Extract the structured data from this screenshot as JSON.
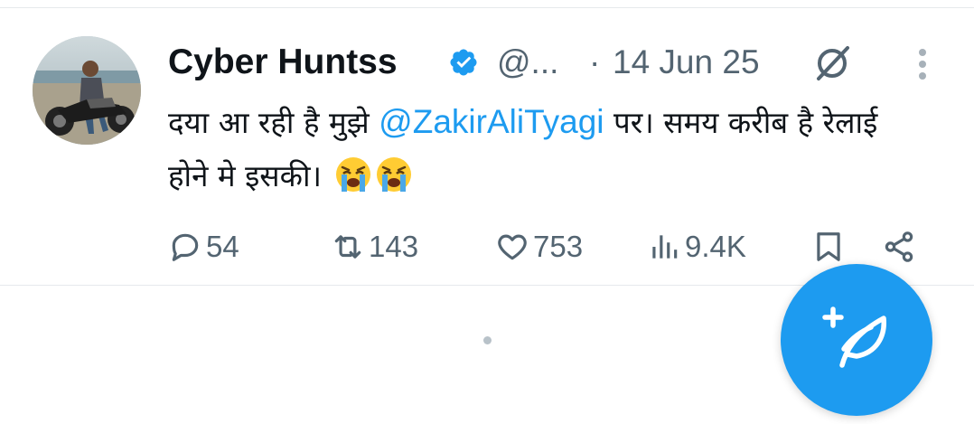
{
  "tweet": {
    "display_name": "Cyber Huntss",
    "handle": "@...",
    "separator": "·",
    "date": "14 Jun 25",
    "text_before_mention": "दया आ रही है मुझे ",
    "mention": "@ZakirAliTyagi",
    "text_after_mention": " पर। समय करीब है रेलाई होने मे इसकी। ",
    "emojis": [
      "loudly-crying-face-emoji",
      "loudly-crying-face-emoji"
    ],
    "metrics": {
      "replies": "54",
      "reposts": "143",
      "likes": "753",
      "views": "9.4K"
    }
  },
  "colors": {
    "accent": "#1d9bf0",
    "text": "#0f1419",
    "muted": "#536471",
    "divider": "#e6e9ec"
  },
  "icons": [
    "verified-badge-icon",
    "grok-icon",
    "more-options-icon",
    "reply-icon",
    "repost-icon",
    "like-icon",
    "views-icon",
    "bookmark-icon",
    "share-icon",
    "compose-icon"
  ]
}
